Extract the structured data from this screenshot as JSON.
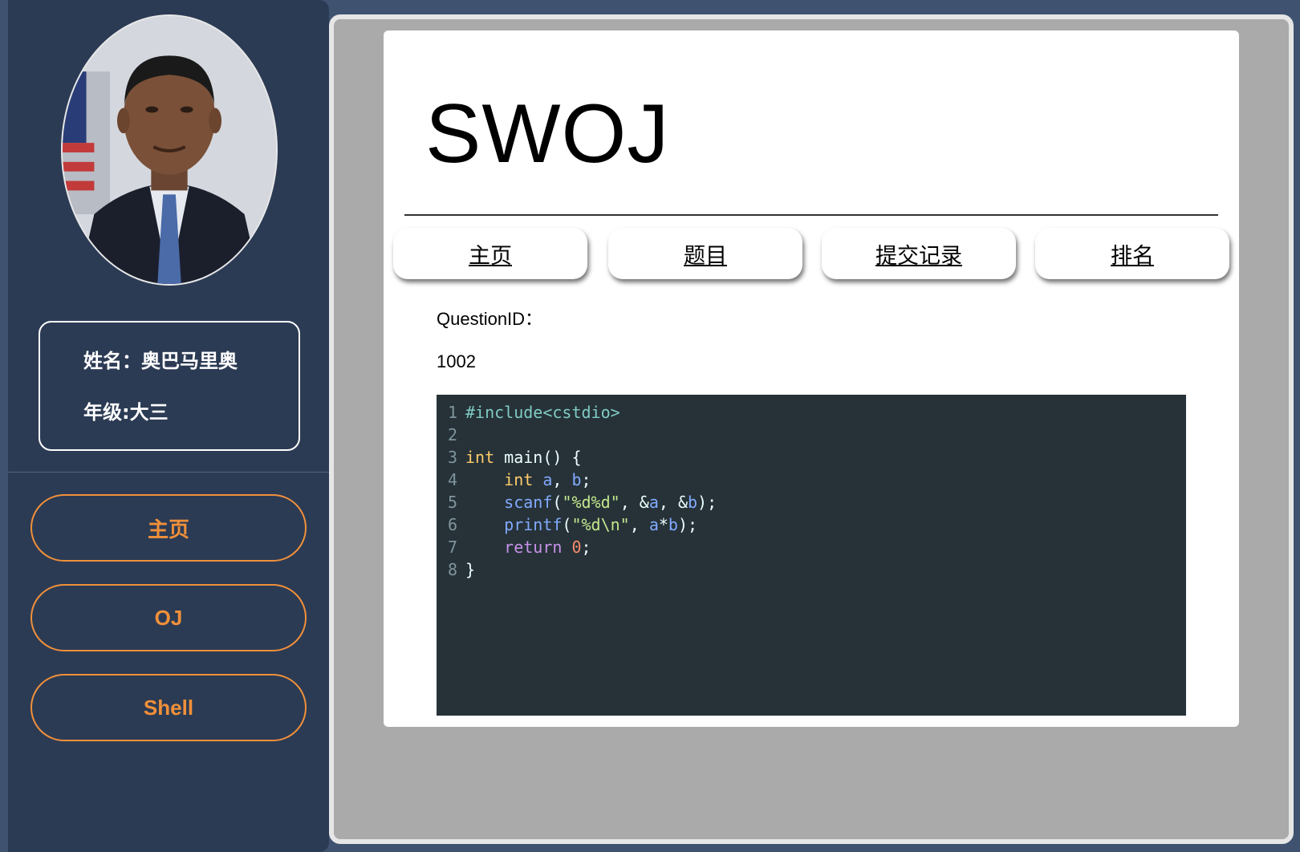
{
  "sidebar": {
    "name_line": "姓名：奥巴马里奥",
    "grade_line": "年级:大三",
    "nav": [
      {
        "label": "主页"
      },
      {
        "label": "OJ"
      },
      {
        "label": "Shell"
      }
    ]
  },
  "header": {
    "brand": "SWOJ"
  },
  "tabs": [
    {
      "label": "主页"
    },
    {
      "label": "题目"
    },
    {
      "label": "提交记录"
    },
    {
      "label": "排名"
    }
  ],
  "question": {
    "label": "QuestionID：",
    "id": "1002"
  },
  "code_editor": {
    "theme": {
      "background": "#263238"
    },
    "lines": [
      {
        "num": "1",
        "tokens": [
          {
            "t": "#include<cstdio>",
            "c": "meta"
          }
        ]
      },
      {
        "num": "2",
        "tokens": []
      },
      {
        "num": "3",
        "tokens": [
          {
            "t": "int",
            "c": "type"
          },
          {
            "t": " main() {",
            "c": "plain"
          }
        ]
      },
      {
        "num": "4",
        "tokens": [
          {
            "t": "    ",
            "c": "plain"
          },
          {
            "t": "int",
            "c": "type"
          },
          {
            "t": " ",
            "c": "plain"
          },
          {
            "t": "a",
            "c": "var"
          },
          {
            "t": ", ",
            "c": "plain"
          },
          {
            "t": "b",
            "c": "var"
          },
          {
            "t": ";",
            "c": "plain"
          }
        ]
      },
      {
        "num": "5",
        "tokens": [
          {
            "t": "    ",
            "c": "plain"
          },
          {
            "t": "scanf",
            "c": "fn"
          },
          {
            "t": "(",
            "c": "plain"
          },
          {
            "t": "\"%d%d\"",
            "c": "str"
          },
          {
            "t": ", &",
            "c": "plain"
          },
          {
            "t": "a",
            "c": "var"
          },
          {
            "t": ", &",
            "c": "plain"
          },
          {
            "t": "b",
            "c": "var"
          },
          {
            "t": ");",
            "c": "plain"
          }
        ]
      },
      {
        "num": "6",
        "tokens": [
          {
            "t": "    ",
            "c": "plain"
          },
          {
            "t": "printf",
            "c": "fn"
          },
          {
            "t": "(",
            "c": "plain"
          },
          {
            "t": "\"%d\\n\"",
            "c": "str"
          },
          {
            "t": ", ",
            "c": "plain"
          },
          {
            "t": "a",
            "c": "var"
          },
          {
            "t": "*",
            "c": "plain"
          },
          {
            "t": "b",
            "c": "var"
          },
          {
            "t": ");",
            "c": "plain"
          }
        ]
      },
      {
        "num": "7",
        "tokens": [
          {
            "t": "    ",
            "c": "plain"
          },
          {
            "t": "return",
            "c": "kw"
          },
          {
            "t": " ",
            "c": "plain"
          },
          {
            "t": "0",
            "c": "num"
          },
          {
            "t": ";",
            "c": "plain"
          }
        ]
      },
      {
        "num": "8",
        "tokens": [
          {
            "t": "}",
            "c": "plain"
          }
        ]
      }
    ]
  }
}
